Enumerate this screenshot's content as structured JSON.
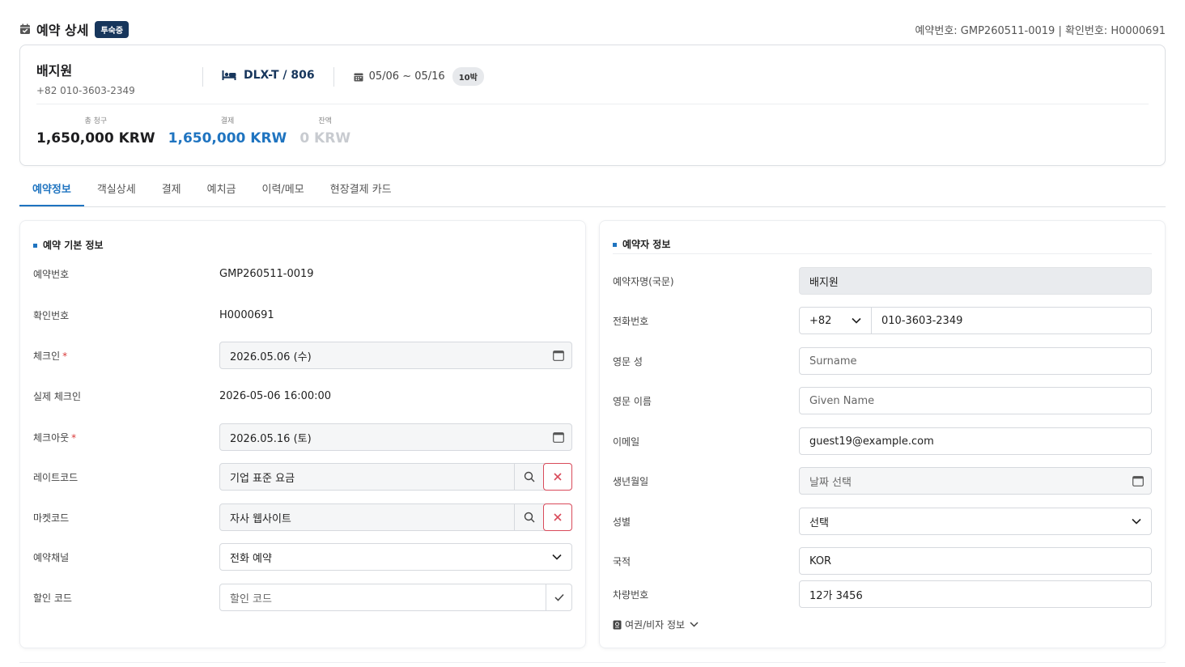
{
  "header": {
    "title": "예약 상세",
    "badge": "투숙중",
    "refs": "예약번호: GMP260511-0019 | 확인번호: H0000691"
  },
  "summary": {
    "guest_name": "배지원",
    "guest_phone": "+82 010-3603-2349",
    "room": "DLX-T / 806",
    "dates": "05/06 ~ 05/16",
    "nights": "10박",
    "total_label": "총 청구",
    "total_value": "1,650,000 KRW",
    "paid_label": "결제",
    "paid_value": "1,650,000 KRW",
    "balance_label": "잔액",
    "balance_value": "0 KRW"
  },
  "tabs": [
    {
      "label": "예약정보",
      "active": true
    },
    {
      "label": "객실상세",
      "active": false
    },
    {
      "label": "결제",
      "active": false
    },
    {
      "label": "예치금",
      "active": false
    },
    {
      "label": "이력/메모",
      "active": false
    },
    {
      "label": "현장결제 카드",
      "active": false
    }
  ],
  "left": {
    "title": "예약 기본 정보",
    "reservation_no_label": "예약번호",
    "reservation_no": "GMP260511-0019",
    "confirm_no_label": "확인번호",
    "confirm_no": "H0000691",
    "checkin_label": "체크인",
    "checkin": "2026.05.06 (수)",
    "actual_checkin_label": "실제 체크인",
    "actual_checkin": "2026-05-06 16:00:00",
    "checkout_label": "체크아웃",
    "checkout": "2026.05.16 (토)",
    "rate_code_label": "레이트코드",
    "rate_code": "기업 표준 요금",
    "market_code_label": "마켓코드",
    "market_code": "자사 웹사이트",
    "channel_label": "예약채널",
    "channel": "전화 예약",
    "discount_label": "할인 코드",
    "discount_placeholder": "할인 코드",
    "required_mark": "*"
  },
  "right": {
    "title": "예약자 정보",
    "name_label": "예약자명(국문)",
    "name": "배지원",
    "phone_label": "전화번호",
    "country_code": "+82",
    "phone": "010-3603-2349",
    "surname_label": "영문 성",
    "surname_placeholder": "Surname",
    "given_label": "영문 이름",
    "given_placeholder": "Given Name",
    "email_label": "이메일",
    "email": "guest19@example.com",
    "birth_label": "생년월일",
    "birth_placeholder": "날짜 선택",
    "gender_label": "성별",
    "gender": "선택",
    "nationality_label": "국적",
    "nationality": "KOR",
    "vehicle_label": "차량번호",
    "vehicle": "12가 3456",
    "passport_toggle": "여권/비자 정보"
  },
  "colors": {
    "accent": "#1f74c0",
    "badge_bg": "#17365c",
    "danger": "#d94a5a"
  }
}
